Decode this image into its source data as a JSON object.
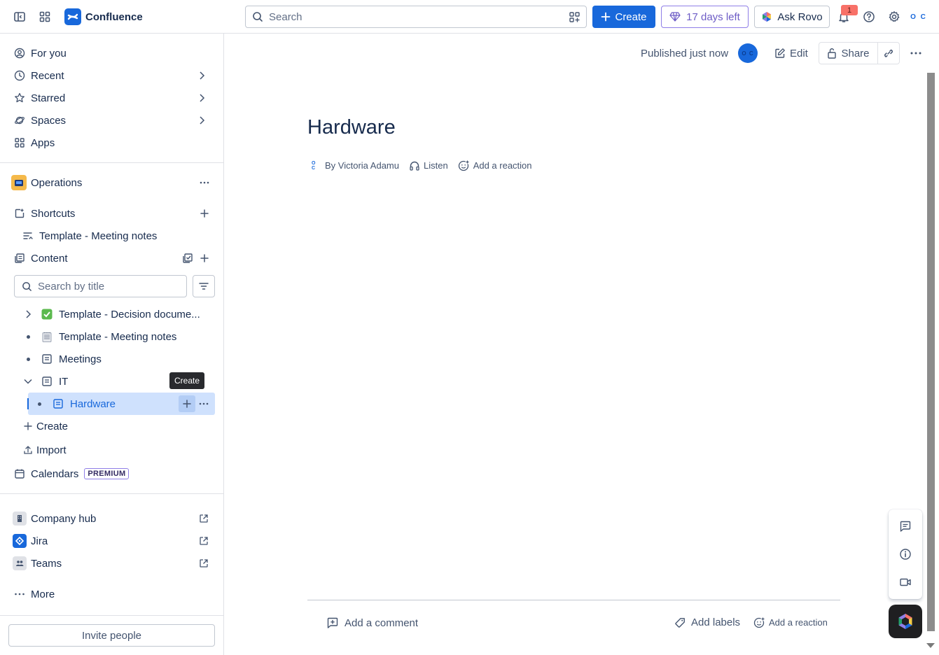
{
  "topbar": {
    "app_name": "Confluence",
    "search_placeholder": "Search",
    "create_label": "Create",
    "trial_label": "17 days left",
    "ask_rovo_label": "Ask Rovo",
    "notification_count": "1",
    "avatar_initials": "O C"
  },
  "sidebar": {
    "nav": [
      {
        "label": "For you"
      },
      {
        "label": "Recent"
      },
      {
        "label": "Starred"
      },
      {
        "label": "Spaces"
      },
      {
        "label": "Apps"
      }
    ],
    "space_name": "Operations",
    "shortcuts_label": "Shortcuts",
    "shortcut_item": "Template - Meeting notes",
    "content_label": "Content",
    "search_placeholder": "Search by title",
    "tree": [
      {
        "label": "Template - Decision docume..."
      },
      {
        "label": "Template - Meeting notes"
      },
      {
        "label": "Meetings"
      },
      {
        "label": "IT"
      },
      {
        "label": "Hardware"
      }
    ],
    "tooltip": "Create",
    "create_label": "Create",
    "import_label": "Import",
    "calendars_label": "Calendars",
    "premium_badge": "PREMIUM",
    "apps": [
      {
        "label": "Company hub"
      },
      {
        "label": "Jira"
      },
      {
        "label": "Teams"
      }
    ],
    "more_label": "More",
    "invite_label": "Invite people"
  },
  "page": {
    "published_status": "Published just now",
    "avatar_initials": "O C",
    "edit_label": "Edit",
    "share_label": "Share",
    "title": "Hardware",
    "byline_author": "By Victoria Adamu",
    "listen_label": "Listen",
    "add_reaction_label": "Add a reaction",
    "add_comment_label": "Add a comment",
    "add_labels_label": "Add labels",
    "footer_reaction_label": "Add a reaction"
  },
  "colors": {
    "brand_blue": "#1868db",
    "selected_bg": "#cfe1fd",
    "trial_purple": "#6e5dc6"
  }
}
